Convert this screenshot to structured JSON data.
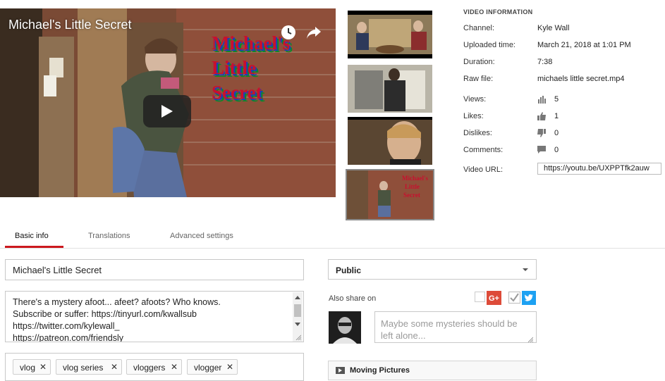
{
  "player": {
    "title": "Michael's Little Secret",
    "overlay_lines": [
      "Michael's",
      "Little",
      "Secret"
    ]
  },
  "info": {
    "heading": "VIDEO INFORMATION",
    "channel_label": "Channel:",
    "channel": "Kyle Wall",
    "uploaded_label": "Uploaded time:",
    "uploaded": "March 21, 2018 at 1:01 PM",
    "duration_label": "Duration:",
    "duration": "7:38",
    "raw_file_label": "Raw file:",
    "raw_file": "michaels little secret.mp4",
    "views_label": "Views:",
    "views": "5",
    "likes_label": "Likes:",
    "likes": "1",
    "dislikes_label": "Dislikes:",
    "dislikes": "0",
    "comments_label": "Comments:",
    "comments": "0",
    "url_label": "Video URL:",
    "url": "https://youtu.be/UXPPTfk2auw"
  },
  "tabs": [
    {
      "label": "Basic info",
      "active": true
    },
    {
      "label": "Translations",
      "active": false
    },
    {
      "label": "Advanced settings",
      "active": false
    }
  ],
  "form": {
    "title": "Michael's Little Secret",
    "description_lines": [
      "There's a mystery afoot... afeet? afoots? Who knows.",
      "Subscribe or suffer: https://tinyurl.com/kwallsub",
      "https://twitter.com/kylewall_",
      "https://patreon.com/friendsly"
    ],
    "tags": [
      "vlog",
      "vlog series",
      "vloggers",
      "vlogger"
    ],
    "tag_remove_glyph": "✕",
    "privacy": "Public",
    "share_label": "Also share on",
    "share_placeholder": "Maybe some mysteries should be left alone...",
    "playlist": "Moving Pictures"
  },
  "colors": {
    "accent": "#cc181e",
    "google_plus": "#dd4b39",
    "twitter": "#1da1f2"
  }
}
